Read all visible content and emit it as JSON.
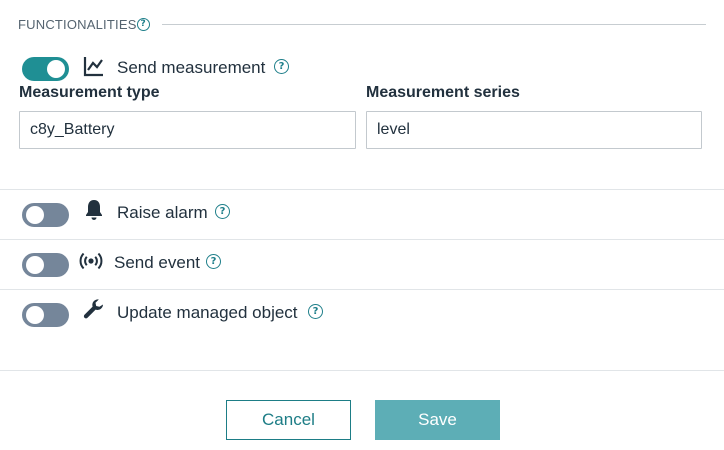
{
  "section": {
    "title": "FUNCTIONALITIES",
    "help_glyph": "?"
  },
  "send_measurement": {
    "enabled": true,
    "label": "Send measurement",
    "icon": "line-chart-icon",
    "measurement_type_label": "Measurement type",
    "measurement_type_value": "c8y_Battery",
    "measurement_series_label": "Measurement series",
    "measurement_series_value": "level"
  },
  "raise_alarm": {
    "enabled": false,
    "label": "Raise alarm",
    "icon": "bell-icon"
  },
  "send_event": {
    "enabled": false,
    "label": "Send event",
    "icon": "broadcast-icon"
  },
  "update_managed_object": {
    "enabled": false,
    "label": "Update managed object",
    "icon": "wrench-icon"
  },
  "actions": {
    "cancel_label": "Cancel",
    "save_label": "Save"
  },
  "colors": {
    "accent": "#1f8f94",
    "toggle_off": "#75869a",
    "save_button": "#5daeb6"
  }
}
